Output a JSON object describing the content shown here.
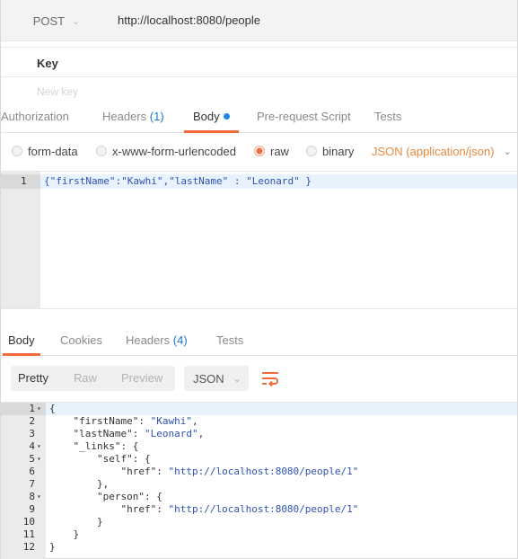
{
  "request": {
    "method": "POST",
    "url": "http://localhost:8080/people"
  },
  "params": {
    "key_header": "Key",
    "new_key_placeholder": "New key"
  },
  "request_tabs": [
    {
      "label": "Authorization"
    },
    {
      "label": "Headers",
      "count": "(1)"
    },
    {
      "label": "Body"
    },
    {
      "label": "Pre-request Script"
    },
    {
      "label": "Tests"
    }
  ],
  "body_types": [
    {
      "label": "form-data",
      "checked": false
    },
    {
      "label": "x-www-form-urlencoded",
      "checked": false
    },
    {
      "label": "raw",
      "checked": true
    },
    {
      "label": "binary",
      "checked": false
    }
  ],
  "content_type": "JSON (application/json)",
  "request_body": {
    "line_number": "1",
    "code": "{\"firstName\":\"Kawhi\",\"lastName\" : \"Leonard\" }"
  },
  "response_tabs": [
    {
      "label": "Body"
    },
    {
      "label": "Cookies"
    },
    {
      "label": "Headers",
      "count": "(4)"
    },
    {
      "label": "Tests"
    }
  ],
  "response_view": {
    "modes": [
      "Pretty",
      "Raw",
      "Preview"
    ],
    "active_mode": "Pretty",
    "format": "JSON",
    "wrap_icon": "wrap-lines-icon"
  },
  "response_body": [
    {
      "n": "1",
      "fold": true,
      "text": "{"
    },
    {
      "n": "2",
      "fold": false,
      "text": "    \"firstName\": \"Kawhi\","
    },
    {
      "n": "3",
      "fold": false,
      "text": "    \"lastName\": \"Leonard\","
    },
    {
      "n": "4",
      "fold": true,
      "text": "    \"_links\": {"
    },
    {
      "n": "5",
      "fold": true,
      "text": "        \"self\": {"
    },
    {
      "n": "6",
      "fold": false,
      "text": "            \"href\": \"http://localhost:8080/people/1\""
    },
    {
      "n": "7",
      "fold": false,
      "text": "        },"
    },
    {
      "n": "8",
      "fold": true,
      "text": "        \"person\": {"
    },
    {
      "n": "9",
      "fold": false,
      "text": "            \"href\": \"http://localhost:8080/people/1\""
    },
    {
      "n": "10",
      "fold": false,
      "text": "        }"
    },
    {
      "n": "11",
      "fold": false,
      "text": "    }"
    },
    {
      "n": "12",
      "fold": false,
      "text": "}"
    }
  ],
  "colors": {
    "accent": "#f26b3a",
    "count_blue": "#1976d2",
    "content_type_orange": "#e8893d",
    "code_string": "#2f52b3"
  }
}
